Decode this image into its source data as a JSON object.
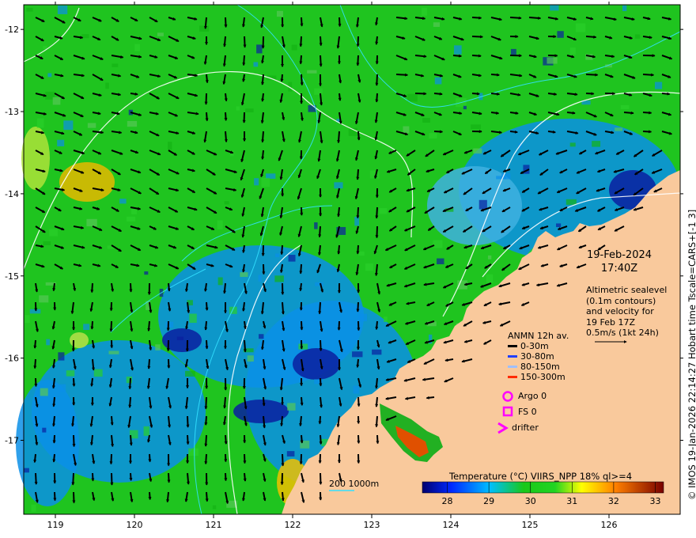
{
  "map_meta": {
    "lon_ticks": [
      "119",
      "120",
      "121",
      "122",
      "123",
      "124",
      "125",
      "126"
    ],
    "lat_ticks": [
      "-12",
      "-13",
      "-14",
      "-15",
      "-16",
      "-17"
    ],
    "lon_range": [
      118.6,
      126.9
    ],
    "lat_range": [
      -11.7,
      -17.9
    ]
  },
  "annotations": {
    "date_line1": "19-Feb-2024",
    "date_line2": "17:40Z",
    "altimetry_lines": [
      "Altimetric sealevel",
      "(0.1m contours)",
      "and velocity for",
      "19 Feb 17Z",
      "0.5m/s (1kt 24h)"
    ]
  },
  "legend": {
    "anmn_title": "ANMN 12h av.",
    "anmn_items": [
      {
        "label": "0-30m",
        "color": "#000000"
      },
      {
        "label": "30-80m",
        "color": "#1f3fff"
      },
      {
        "label": "80-150m",
        "color": "#9fbfff"
      },
      {
        "label": "150-300m",
        "color": "#ff2a00"
      }
    ],
    "markers": [
      {
        "label": "Argo 0",
        "color": "#ff00ff",
        "shape": "circle"
      },
      {
        "label": "FS 0",
        "color": "#ff00ff",
        "shape": "square"
      },
      {
        "label": "drifter",
        "color": "#ff00ff",
        "shape": "chevron"
      }
    ]
  },
  "colorbar": {
    "title": "Temperature (°C) VIIRS_NPP 18% ql>=4",
    "ticks": [
      "28",
      "29",
      "30",
      "31",
      "32",
      "33"
    ],
    "range": [
      27.4,
      33.2
    ]
  },
  "scale_label": "200  1000m",
  "credit": "© IMOS 19-Jan-2026 22:14:27 Hobart time Tscale=CARS+[-1 3]",
  "colors": {
    "land": "#f9c99c",
    "water_green": "#1fc41f",
    "water_blue": "#0a8fe8"
  }
}
